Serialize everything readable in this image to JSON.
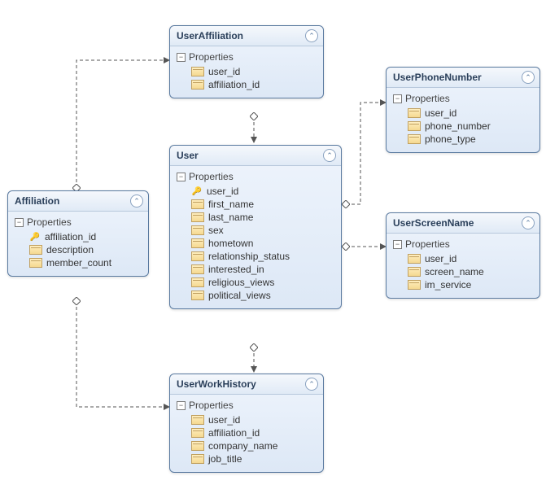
{
  "props_label": "Properties",
  "entities": {
    "UserAffiliation": {
      "title": "UserAffiliation",
      "properties": [
        "user_id",
        "affiliation_id"
      ],
      "keys": []
    },
    "UserPhoneNumber": {
      "title": "UserPhoneNumber",
      "properties": [
        "user_id",
        "phone_number",
        "phone_type"
      ],
      "keys": []
    },
    "Affiliation": {
      "title": "Affiliation",
      "properties": [
        "affiliation_id",
        "description",
        "member_count"
      ],
      "keys": [
        "affiliation_id"
      ]
    },
    "User": {
      "title": "User",
      "properties": [
        "user_id",
        "first_name",
        "last_name",
        "sex",
        "hometown",
        "relationship_status",
        "interested_in",
        "religious_views",
        "political_views"
      ],
      "keys": [
        "user_id"
      ]
    },
    "UserScreenName": {
      "title": "UserScreenName",
      "properties": [
        "user_id",
        "screen_name",
        "im_service"
      ],
      "keys": []
    },
    "UserWorkHistory": {
      "title": "UserWorkHistory",
      "properties": [
        "user_id",
        "affiliation_id",
        "company_name",
        "job_title"
      ],
      "keys": []
    }
  }
}
